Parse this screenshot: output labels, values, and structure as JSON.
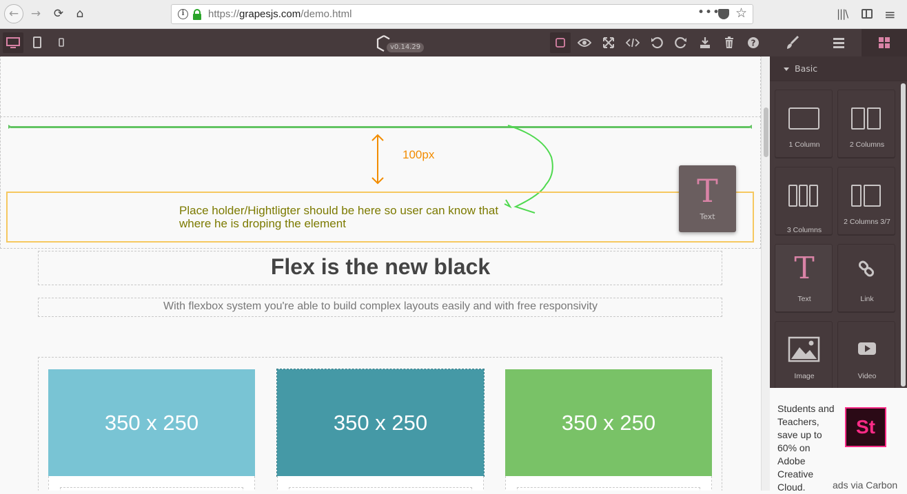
{
  "browser": {
    "url_scheme": "https://",
    "url_host": "grapesjs.com",
    "url_path": "/demo.html",
    "more_label": "•••",
    "star": "☆"
  },
  "editor": {
    "version": "v0.14.29",
    "colors": {
      "panel_bg": "#463a3c",
      "accent": "#d983a6",
      "text": "#c9c5c5"
    }
  },
  "canvas": {
    "annotation_measure": "100px",
    "annotation_note": "Place holder/Hightligter should be here so user can know that where he is droping the element",
    "drag_ghost": {
      "icon": "T",
      "label": "Text"
    },
    "title": "Flex is the new black",
    "subtitle": "With flexbox system you're able to build complex layouts easily and with free responsivity",
    "cards": [
      {
        "label": "350 x 250",
        "color": "#79c4d4"
      },
      {
        "label": "350 x 250",
        "color": "#4599a6"
      },
      {
        "label": "350 x 250",
        "color": "#79c267"
      }
    ]
  },
  "blocks": {
    "category": "Basic",
    "items": [
      {
        "label": "1 Column"
      },
      {
        "label": "2 Columns"
      },
      {
        "label": "3 Columns"
      },
      {
        "label": "2 Columns 3/7"
      },
      {
        "label": "Text",
        "icon": "T"
      },
      {
        "label": "Link"
      },
      {
        "label": "Image"
      },
      {
        "label": "Video"
      }
    ]
  },
  "ad": {
    "text": "Students and Teachers, save up to 60% on Adobe Creative Cloud.",
    "logo_text": "St",
    "credit": "ads via Carbon"
  }
}
